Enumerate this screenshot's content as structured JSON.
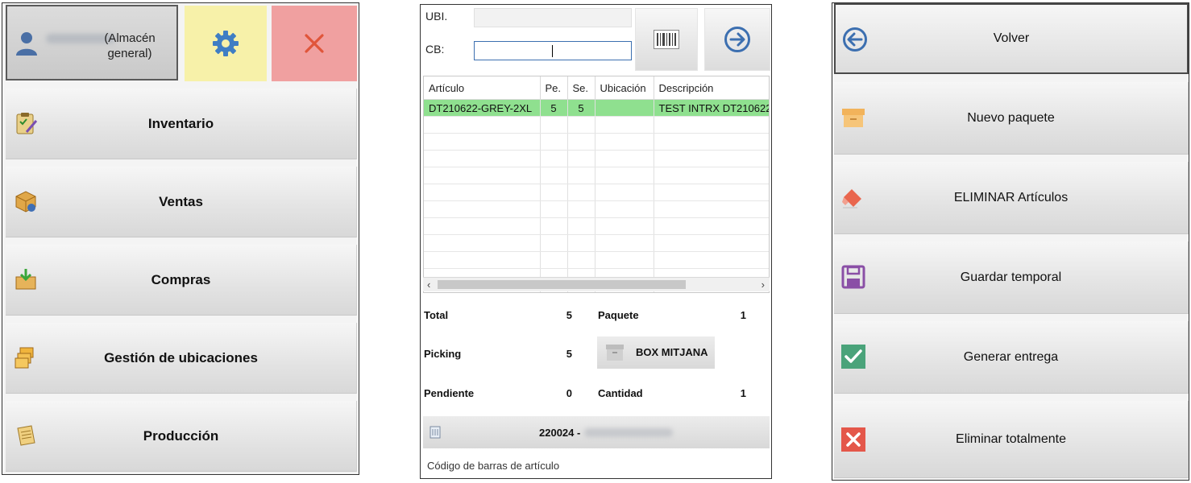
{
  "menu_panel": {
    "user_location": "(Almacén general)",
    "items": [
      {
        "label": "Inventario",
        "icon": "clipboard-icon"
      },
      {
        "label": "Ventas",
        "icon": "box-icon"
      },
      {
        "label": "Compras",
        "icon": "tray-download-icon"
      },
      {
        "label": "Gestión de ubicaciones",
        "icon": "stacked-boxes-icon"
      },
      {
        "label": "Producción",
        "icon": "document-icon"
      }
    ]
  },
  "picking_panel": {
    "ubi_label": "UBI.",
    "ubi_value": "",
    "cb_label": "CB:",
    "cb_value": "",
    "table": {
      "columns": [
        "Artículo",
        "Pe.",
        "Se.",
        "Ubicación",
        "Descripción"
      ],
      "rows": [
        {
          "articulo": "DT210622-GREY-2XL",
          "pe": "5",
          "se": "5",
          "ubicacion": "",
          "descripcion": "TEST INTRX DT210622"
        }
      ]
    },
    "summary": {
      "total_label": "Total",
      "total_value": "5",
      "paquete_label": "Paquete",
      "paquete_value": "1",
      "picking_label": "Picking",
      "picking_value": "5",
      "box_button_label": "BOX MITJANA",
      "pendiente_label": "Pendiente",
      "pendiente_value": "0",
      "cantidad_label": "Cantidad",
      "cantidad_value": "1"
    },
    "order_label": "220024 -",
    "status_text": "Código de barras de artículo"
  },
  "actions_panel": {
    "items": [
      {
        "label": "Volver",
        "icon": "arrow-left-circle-icon"
      },
      {
        "label": "Nuevo paquete",
        "icon": "package-icon"
      },
      {
        "label": "ELIMINAR Artículos",
        "icon": "eraser-icon"
      },
      {
        "label": "Guardar temporal",
        "icon": "floppy-disk-icon"
      },
      {
        "label": "Generar entrega",
        "icon": "checkmark-icon"
      },
      {
        "label": "Eliminar totalmente",
        "icon": "delete-x-icon"
      }
    ]
  },
  "colors": {
    "settings_bg": "#f7f1a9",
    "close_bg": "#f0a0a0",
    "selected_row": "#8fe08f",
    "accent_blue": "#3c6fb0"
  }
}
